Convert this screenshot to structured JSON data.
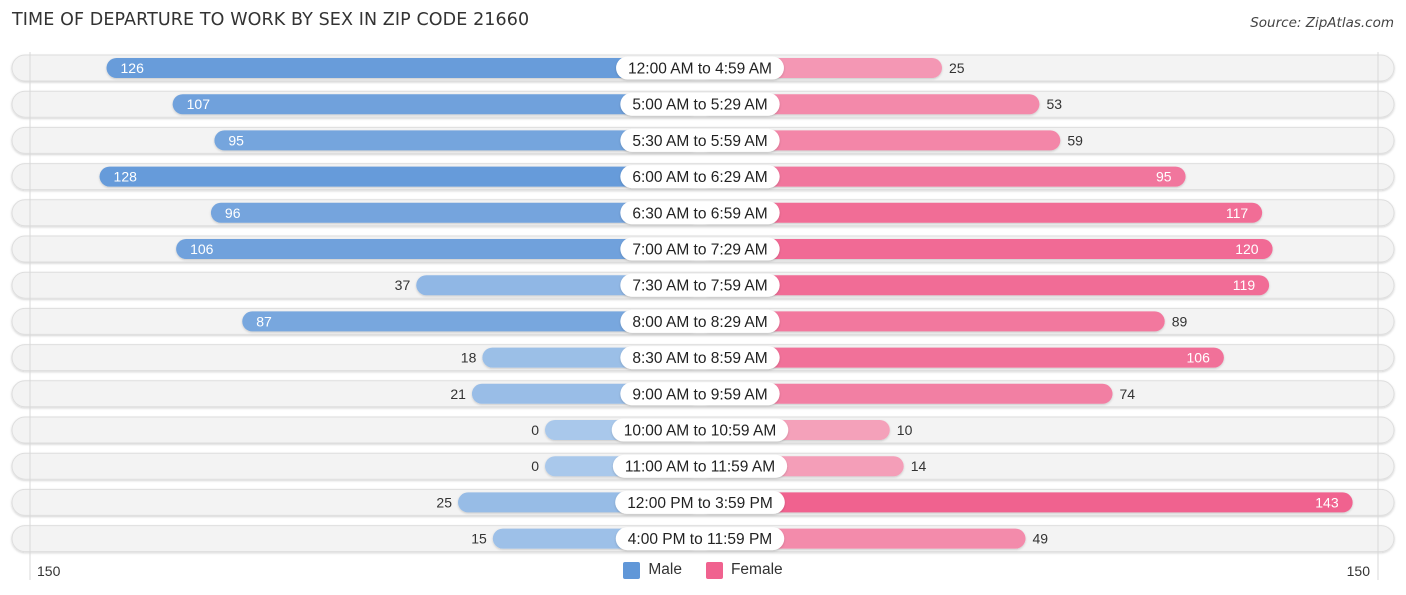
{
  "header": {
    "title": "TIME OF DEPARTURE TO WORK BY SEX IN ZIP CODE 21660",
    "source": "Source: ZipAtlas.com"
  },
  "colors": {
    "male": "#6097d8",
    "male_light": "#a9c8eb",
    "female": "#f0628f",
    "female_light": "#f5a9c0",
    "row_bg": "#f3f3f3"
  },
  "chart_data": {
    "type": "bar",
    "orientation": "horizontal-diverging",
    "title": "TIME OF DEPARTURE TO WORK BY SEX IN ZIP CODE 21660",
    "categories": [
      "12:00 AM to 4:59 AM",
      "5:00 AM to 5:29 AM",
      "5:30 AM to 5:59 AM",
      "6:00 AM to 6:29 AM",
      "6:30 AM to 6:59 AM",
      "7:00 AM to 7:29 AM",
      "7:30 AM to 7:59 AM",
      "8:00 AM to 8:29 AM",
      "8:30 AM to 8:59 AM",
      "9:00 AM to 9:59 AM",
      "10:00 AM to 10:59 AM",
      "11:00 AM to 11:59 AM",
      "12:00 PM to 3:59 PM",
      "4:00 PM to 11:59 PM"
    ],
    "series": [
      {
        "name": "Male",
        "values": [
          126,
          107,
          95,
          128,
          96,
          106,
          37,
          87,
          18,
          21,
          0,
          0,
          25,
          15
        ]
      },
      {
        "name": "Female",
        "values": [
          25,
          53,
          59,
          95,
          117,
          120,
          119,
          89,
          106,
          74,
          10,
          14,
          143,
          49
        ]
      }
    ],
    "axis": {
      "left_max_label": "150",
      "right_max_label": "150",
      "max": 150
    },
    "legend": {
      "position": "bottom-center",
      "entries": [
        "Male",
        "Female"
      ]
    },
    "grid": false
  }
}
